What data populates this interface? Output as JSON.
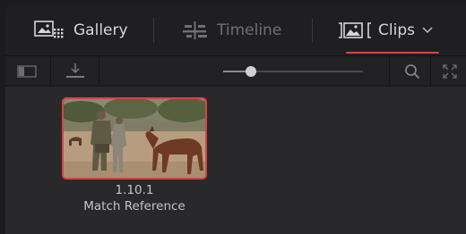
{
  "tabs": [
    {
      "label": "Gallery",
      "icon": "gallery-icon",
      "active": false
    },
    {
      "label": "Timeline",
      "icon": "timeline-icon",
      "active": false
    },
    {
      "label": "Clips",
      "icon": "clips-icon",
      "active": true
    }
  ],
  "toolbar": {
    "zoom_slider_value": 0.2,
    "icons": [
      "sidebar-toggle-icon",
      "import-icon",
      "search-icon",
      "fullscreen-icon"
    ]
  },
  "clips": [
    {
      "number": "1.10.1",
      "name": "Match Reference",
      "selected": true
    }
  ],
  "colors": {
    "accent": "#d2473e",
    "background": "#28282b",
    "tabbar": "#1f1f22"
  }
}
